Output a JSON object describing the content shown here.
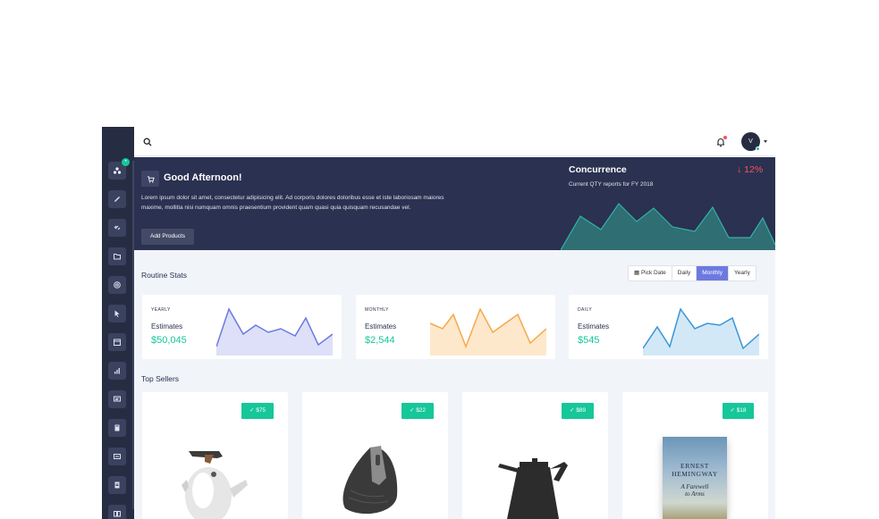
{
  "topbar": {
    "avatar_initial": "V"
  },
  "hero": {
    "title": "Good Afternoon!",
    "text": "Lorem ipsum dolor sit amet, consectetur adipisicing elit. Ad corporis dolores doloribus esse et iste laboriosam maiores maxime, mollitia nisi numquam omnis praesentium provident quam quasi quia quisquam recusandae vel.",
    "button": "Add Products",
    "concurrence_title": "Concurrence",
    "concurrence_sub": "Current QTY reports for FY 2018",
    "concurrence_pct": "↓ 12%"
  },
  "routine": {
    "title": "Routine Stats",
    "pick_date": "Pick Date",
    "tabs": [
      "Daily",
      "Monthly",
      "Yearly"
    ],
    "active_tab": "Monthly"
  },
  "stats": [
    {
      "label": "YEARLY",
      "estimates": "Estimates",
      "value": "$50,045",
      "color": "#6c7ae0",
      "fill": "#dde0f8"
    },
    {
      "label": "MONTHLY",
      "estimates": "Estimates",
      "value": "$2,544",
      "color": "#f5a94a",
      "fill": "#fde8cc"
    },
    {
      "label": "DAILY",
      "estimates": "Estimates",
      "value": "$545",
      "color": "#3a96d8",
      "fill": "#d3e8f6"
    }
  ],
  "top_sellers": {
    "title": "Top Sellers",
    "items": [
      {
        "price": "✓ $75"
      },
      {
        "price": "✓ $22"
      },
      {
        "price": "✓ $89"
      },
      {
        "price": "✓ $18",
        "book_author_1": "ERNEST",
        "book_author_2": "HEMINGWAY",
        "book_title_1": "A Farewell",
        "book_title_2": "to Arms"
      }
    ]
  },
  "colors": {
    "sidebar": "#262d42",
    "hero": "#2b3150",
    "accent": "#16c79a",
    "brand": "#6c7ae0",
    "negative": "#f2545b"
  }
}
